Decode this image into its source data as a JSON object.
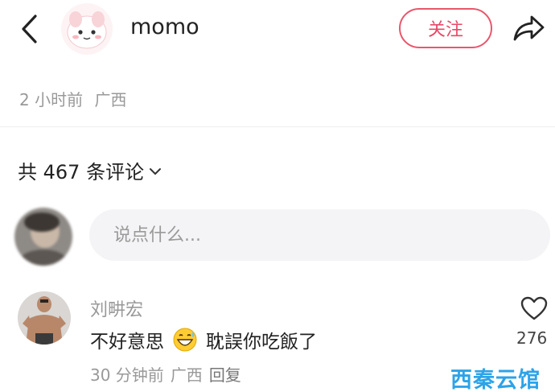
{
  "header": {
    "username": "momo",
    "follow_label": "关注"
  },
  "post_meta": {
    "time": "2 小时前",
    "location": "广西"
  },
  "comments": {
    "count_text": "共 467 条评论",
    "input_placeholder": "说点什么..."
  },
  "comment": {
    "author": "刘畊宏",
    "text_before_emoji": "不好意思",
    "emoji": "grinning-sweat-emoji",
    "text_after_emoji": "耽誤你吃飯了",
    "time": "30 分钟前",
    "location": "广西",
    "reply_label": "回复",
    "likes": "276"
  },
  "watermark": {
    "text": "西秦云馆"
  },
  "colors": {
    "follow_accent": "#e8486a",
    "muted_text": "#999999",
    "input_bg": "#f4f4f6",
    "watermark": "#2da3e8"
  },
  "icons": {
    "back": "chevron-left-icon",
    "share": "share-arrow-icon",
    "dropdown": "chevron-down-icon",
    "like": "heart-outline-icon"
  }
}
